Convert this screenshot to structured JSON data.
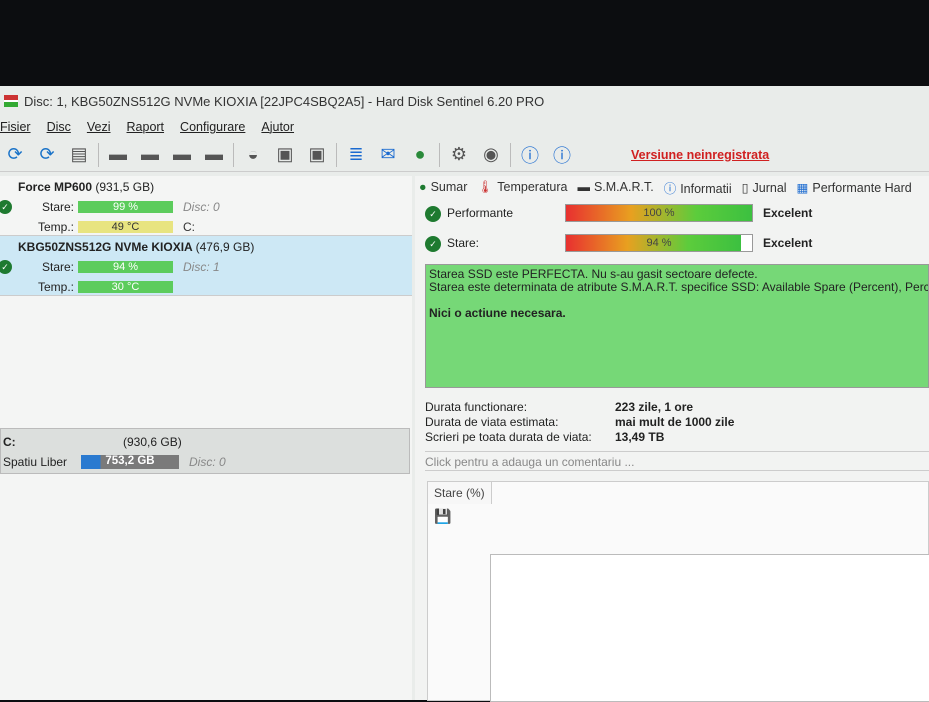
{
  "window": {
    "title": "Disc: 1, KBG50ZNS512G NVMe KIOXIA [22JPC4SBQ2A5]  -  Hard Disk Sentinel 6.20 PRO"
  },
  "menu": [
    "Fisier",
    "Disc",
    "Vezi",
    "Raport",
    "Configurare",
    "Ajutor"
  ],
  "toolbar": {
    "unregistered": "Versiune neinregistrata"
  },
  "disks": [
    {
      "name": "Force MP600",
      "size": "(931,5 GB)",
      "state_label": "Stare:",
      "state": "99 %",
      "disc": "Disc: 0",
      "temp_label": "Temp.:",
      "temp": "49 °C",
      "drive": "C:"
    },
    {
      "name": "KBG50ZNS512G NVMe KIOXIA",
      "size": "(476,9 GB)",
      "state_label": "Stare:",
      "state": "94 %",
      "disc": "Disc: 1",
      "temp_label": "Temp.:",
      "temp": "30 °C"
    }
  ],
  "partition": {
    "drive": "C:",
    "size": "(930,6 GB)",
    "free_label": "Spatiu Liber",
    "free": "753,2 GB",
    "disc": "Disc: 0"
  },
  "tabs": [
    "Sumar",
    "Temperatura",
    "S.M.A.R.T.",
    "Informatii",
    "Jurnal",
    "Performante Hard"
  ],
  "health": [
    {
      "label": "Performante",
      "value": "100 %",
      "percent": 100,
      "rating": "Excelent"
    },
    {
      "label": "Stare:",
      "value": "94 %",
      "percent": 94,
      "rating": "Excelent"
    }
  ],
  "message": {
    "line1": "Starea SSD este PERFECTA. Nu s-au gasit sectoare defecte.",
    "line2": "Starea este determinata de atribute S.M.A.R.T. specifice SSD: Available Spare (Percent), Percentage Used",
    "action": "Nici o actiune necesara."
  },
  "stats": [
    {
      "k": "Durata functionare:",
      "v": "223 zile, 1 ore"
    },
    {
      "k": "Durata de viata estimata:",
      "v": "mai mult de 1000 zile"
    },
    {
      "k": "Scrieri pe toata durata de viata:",
      "v": "13,49 TB"
    }
  ],
  "comment_placeholder": "Click pentru a adauga un comentariu ...",
  "chart": {
    "tab": "Stare (%)"
  }
}
